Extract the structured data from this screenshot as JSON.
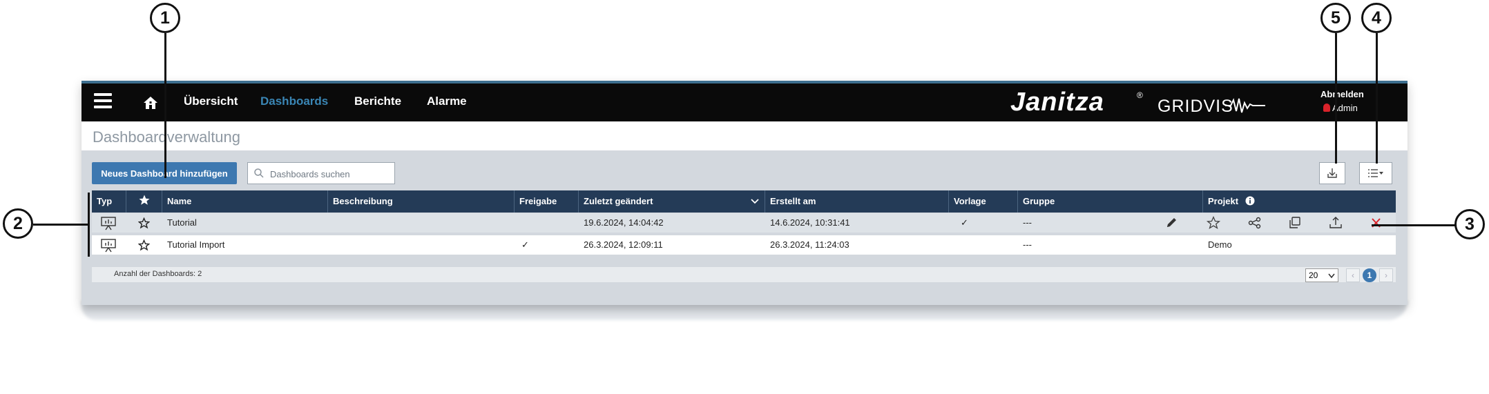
{
  "nav": {
    "items": [
      "Übersicht",
      "Dashboards",
      "Berichte",
      "Alarme"
    ],
    "active_index": 1,
    "brand": "Janitza",
    "brand_reg": "®",
    "brand_product": "GRIDVIS",
    "logout_label": "Abmelden",
    "user": "Admin"
  },
  "page": {
    "title": "Dashboardverwaltung"
  },
  "toolbar": {
    "add_label": "Neues Dashboard hinzufügen",
    "search_placeholder": "Dashboards suchen",
    "search_value": ""
  },
  "table": {
    "columns": [
      "Typ",
      "",
      "Name",
      "Beschreibung",
      "Freigabe",
      "Zuletzt geändert",
      "Erstellt am",
      "Vorlage",
      "Gruppe",
      "Projekt"
    ],
    "sorted_column": "Zuletzt geändert",
    "rows": [
      {
        "name": "Tutorial",
        "description": "",
        "shared": "",
        "modified": "19.6.2024, 14:04:42",
        "created": "14.6.2024, 10:31:41",
        "template": "✓",
        "group": "---",
        "project": ""
      },
      {
        "name": "Tutorial Import",
        "description": "",
        "shared": "✓",
        "modified": "26.3.2024, 12:09:11",
        "created": "26.3.2024, 11:24:03",
        "template": "",
        "group": "---",
        "project": "Demo"
      }
    ],
    "row_actions": [
      "pencil-icon",
      "star-icon",
      "share-icon",
      "copy-icon",
      "upload-icon",
      "delete-icon"
    ]
  },
  "footer": {
    "count_label": "Anzahl der Dashboards: 2",
    "page_size": "20",
    "current_page": "1",
    "prev": "‹",
    "next": "›"
  },
  "callouts": [
    "1",
    "2",
    "3",
    "4",
    "5"
  ],
  "colors": {
    "accent": "#3d78b0",
    "header": "#243b57",
    "topbar": "#0a0a0a",
    "delete": "#d9222a"
  }
}
